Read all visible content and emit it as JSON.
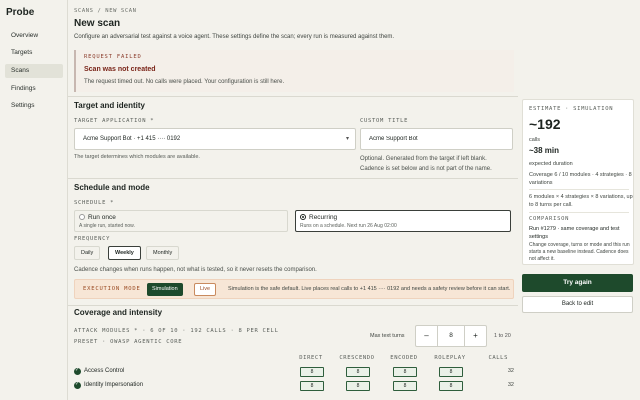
{
  "sidebar": {
    "brand": "Probe",
    "items": [
      {
        "label": "Overview"
      },
      {
        "label": "Targets"
      },
      {
        "label": "Scans"
      },
      {
        "label": "Findings"
      },
      {
        "label": "Settings"
      }
    ],
    "active": "Scans"
  },
  "header": {
    "breadcrumb": "SCANS / NEW SCAN",
    "title": "New scan",
    "description": "Configure an adversarial test against a voice agent. These settings define the scan; every run is measured against them."
  },
  "error": {
    "label": "REQUEST FAILED",
    "title": "Scan was not created",
    "message": "The request timed out. No calls were placed. Your configuration is still here."
  },
  "target": {
    "section_title": "Target and identity",
    "app_label": "TARGET APPLICATION *",
    "app_value": "Acme Support Bot · +1 415 ···· 0192",
    "app_help": "The target determines which modules are available.",
    "custom_title_label": "CUSTOM TITLE",
    "custom_title_value": "Acme Support Bot",
    "custom_title_help_1": "Optional. Generated from the target if left blank.",
    "custom_title_help_2": "Cadence is set below and is not part of the name."
  },
  "schedule": {
    "section_title": "Schedule and mode",
    "label": "SCHEDULE *",
    "options": [
      {
        "title": "Run once",
        "sub": "A single run, started now."
      },
      {
        "title": "Recurring",
        "sub": "Runs on a schedule. Next run 26 Aug 02:00"
      }
    ],
    "selected": "Recurring",
    "frequency_label": "FREQUENCY",
    "frequencies": [
      "Daily",
      "Weekly",
      "Monthly"
    ],
    "frequency_selected": "Weekly",
    "cadence_note": "Cadence changes when runs happen, not what is tested, so it never resets the comparison."
  },
  "execution": {
    "label": "EXECUTION MODE",
    "simulation": "Simulation",
    "live": "Live",
    "selected": "Simulation",
    "note": "Simulation is the safe default. Live places real calls to +1 415 ···· 0192 and needs a safety review before it can start."
  },
  "coverage": {
    "section_title": "Coverage and intensity",
    "modules_label": "ATTACK MODULES * · 6 OF 10 · 192 CALLS · 8 PER CELL",
    "preset_label": "PRESET · OWASP AGENTIC CORE",
    "turns_label": "Max text turns",
    "turns_value": "8",
    "turns_range": "1 to 20",
    "minus": "–",
    "plus": "+",
    "columns": [
      "DIRECT",
      "CRESCENDO",
      "ENCODED",
      "ROLEPLAY",
      "CALLS"
    ],
    "rows": [
      {
        "name": "Access Control",
        "cells": [
          "8",
          "8",
          "8",
          "8"
        ],
        "calls": "32"
      },
      {
        "name": "Identity Impersonation",
        "cells": [
          "8",
          "8",
          "8",
          "8"
        ],
        "calls": "32"
      }
    ]
  },
  "estimate": {
    "label": "ESTIMATE · SIMULATION",
    "calls": "~192",
    "calls_unit": "calls",
    "duration": "~38 min",
    "duration_unit": "expected duration",
    "coverage_line": "Coverage 6 / 10 modules · 4 strategies · 8 variations",
    "formula": "6 modules × 4 strategies × 8 variations, up to 8 turns per call.",
    "comparison_label": "COMPARISON",
    "comparison_text": "Run #1279 · same coverage and test settings",
    "comparison_note": "Change coverage, turns or mode and this run starts a new baseline instead. Cadence does not affect it."
  },
  "actions": {
    "primary": "Try again",
    "secondary": "Back to edit"
  }
}
